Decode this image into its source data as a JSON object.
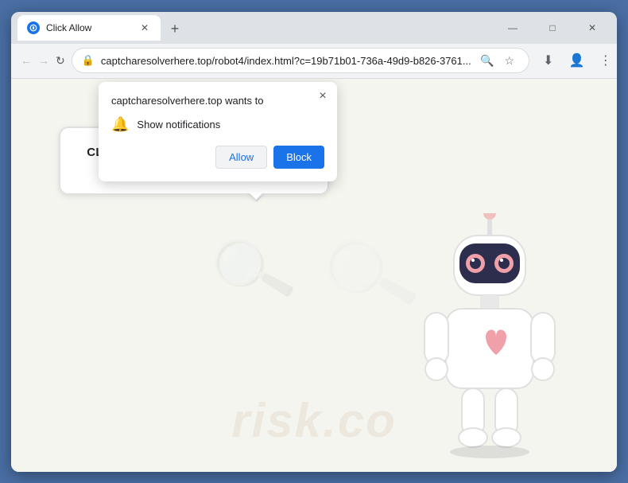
{
  "window": {
    "title": "Click Allow",
    "controls": {
      "minimize": "—",
      "maximize": "□",
      "close": "✕"
    }
  },
  "tab": {
    "title": "Click Allow",
    "favicon_color": "#1a73e8"
  },
  "addressbar": {
    "url": "captcharesolverhere.top/robot4/index.html?c=19b71b01-736a-49d9-b826-3761...",
    "lock_symbol": "🔒"
  },
  "toolbar": {
    "download_label": "⬇",
    "profile_label": "👤",
    "menu_label": "⋮"
  },
  "notification_popup": {
    "title": "captcharesolverhere.top wants to",
    "close_label": "×",
    "permission_label": "Show notifications",
    "allow_label": "Allow",
    "block_label": "Block"
  },
  "page": {
    "speech_text": "CLICK «ALLOW» TO CONFIRM THAT YOU ARE NOT A ROBOT!",
    "watermark_text": "risk.co"
  }
}
